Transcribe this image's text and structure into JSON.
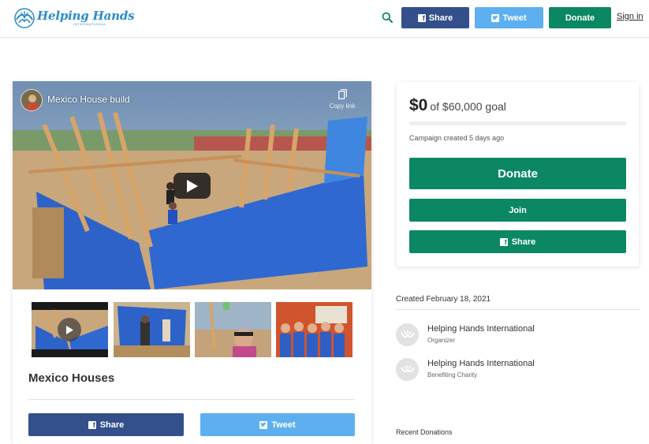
{
  "header": {
    "logo_title": "Helping Hands",
    "logo_subtitle": "INTERNATIONAL",
    "share_label": "Share",
    "tweet_label": "Tweet",
    "donate_label": "Donate",
    "signin_label": "Sign in"
  },
  "video": {
    "title": "Mexico House build",
    "copy_link_label": "Copy link"
  },
  "campaign": {
    "title": "Mexico Houses",
    "share_label": "Share",
    "tweet_label": "Tweet"
  },
  "donation": {
    "raised": "$0",
    "goal_text": "of $60,000 goal",
    "progress_percent": 0,
    "created_ago": "Campaign created 5 days ago",
    "donate_label": "Donate",
    "join_label": "Join",
    "share_label": "Share"
  },
  "details": {
    "created_date": "Created February 18, 2021",
    "organizations": [
      {
        "name": "Helping Hands International",
        "role": "Organizer"
      },
      {
        "name": "Helping Hands International",
        "role": "Benefiting Charity"
      }
    ],
    "recent_donations_label": "Recent Donations"
  },
  "colors": {
    "brand_blue": "#2a8cc9",
    "facebook": "#33508b",
    "twitter": "#5eaff0",
    "donate_green": "#0c8764"
  }
}
